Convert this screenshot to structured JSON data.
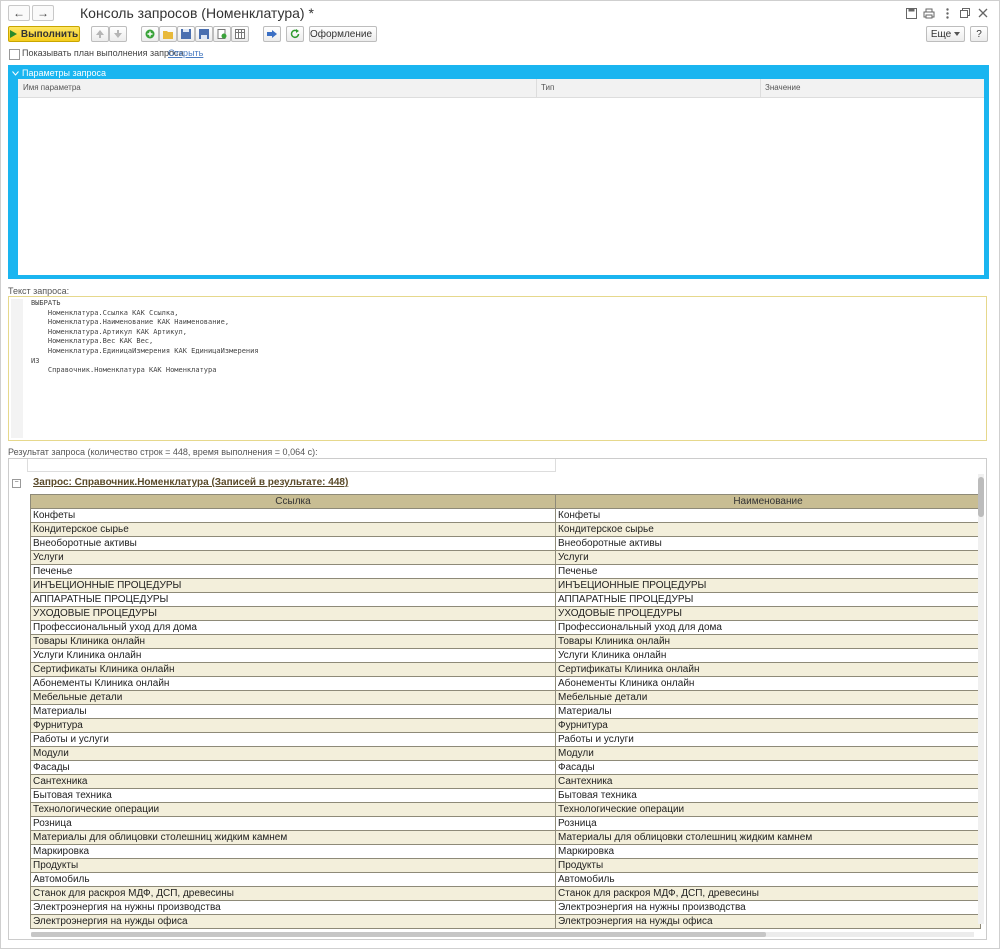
{
  "window": {
    "title": "Консоль запросов (Номенклатура) *",
    "nav_back": "←",
    "nav_forward": "→",
    "icons": [
      "save-icon",
      "print-icon",
      "menu-icon",
      "restore-icon",
      "close-icon"
    ]
  },
  "toolbar": {
    "run_label": "Выполнить",
    "design_label": "Оформление",
    "more_label": "Еще",
    "help_label": "?",
    "colors": {
      "accent": "#1ab5f0",
      "primary_button": "#f5cc1e"
    }
  },
  "options": {
    "show_plan_label": "Показывать план выполнения запроса",
    "open_link": "Открыть"
  },
  "params": {
    "header": "Параметры запроса",
    "columns": [
      "Имя параметра",
      "Тип",
      "Значение"
    ]
  },
  "query": {
    "label": "Текст запроса:",
    "text": "ВЫБРАТЬ\n    Номенклатура.Ссылка КАК Ссылка,\n    Номенклатура.Наименование КАК Наименование,\n    Номенклатура.Артикул КАК Артикул,\n    Номенклатура.Вес КАК Вес,\n    Номенклатура.ЕдиницаИзмерения КАК ЕдиницаИзмерения\nИЗ\n    Справочник.Номенклатура КАК Номенклатура"
  },
  "result": {
    "label": "Результат запроса (количество строк = 448, время выполнения = 0,064 с):",
    "title": "Запрос: Справочник.Номенклатура (Записей в результате: 448)",
    "columns": [
      "Ссылка",
      "Наименование"
    ],
    "rows": [
      [
        "Конфеты",
        "Конфеты"
      ],
      [
        "Кондитерское сырье",
        "Кондитерское сырье"
      ],
      [
        "Внеоборотные активы",
        "Внеоборотные активы"
      ],
      [
        "Услуги",
        "Услуги"
      ],
      [
        "Печенье",
        "Печенье"
      ],
      [
        "ИНЪЕЦИОННЫЕ ПРОЦЕДУРЫ",
        "ИНЪЕЦИОННЫЕ ПРОЦЕДУРЫ"
      ],
      [
        "АППАРАТНЫЕ ПРОЦЕДУРЫ",
        "АППАРАТНЫЕ ПРОЦЕДУРЫ"
      ],
      [
        "УХОДОВЫЕ ПРОЦЕДУРЫ",
        "УХОДОВЫЕ ПРОЦЕДУРЫ"
      ],
      [
        "Профессиональный уход для дома",
        "Профессиональный уход для дома"
      ],
      [
        "Товары Клиника онлайн",
        "Товары Клиника онлайн"
      ],
      [
        "Услуги Клиника онлайн",
        "Услуги Клиника онлайн"
      ],
      [
        "Сертификаты Клиника онлайн",
        "Сертификаты Клиника онлайн"
      ],
      [
        "Абонементы Клиника онлайн",
        "Абонементы Клиника онлайн"
      ],
      [
        "Мебельные детали",
        "Мебельные детали"
      ],
      [
        "Материалы",
        "Материалы"
      ],
      [
        "Фурнитура",
        "Фурнитура"
      ],
      [
        "Работы и услуги",
        "Работы и услуги"
      ],
      [
        "Модули",
        "Модули"
      ],
      [
        "Фасады",
        "Фасады"
      ],
      [
        "Сантехника",
        "Сантехника"
      ],
      [
        "Бытовая техника",
        "Бытовая техника"
      ],
      [
        "Технологические операции",
        "Технологические операции"
      ],
      [
        "Розница",
        "Розница"
      ],
      [
        "Материалы для облицовки столешниц жидким камнем",
        "Материалы для облицовки столешниц жидким камнем"
      ],
      [
        "Маркировка",
        "Маркировка"
      ],
      [
        "Продукты",
        "Продукты"
      ],
      [
        "Автомобиль",
        "Автомобиль"
      ],
      [
        "Станок для раскроя МДФ, ДСП, древесины",
        "Станок для раскроя МДФ, ДСП, древесины"
      ],
      [
        "Электроэнергия на нужны производства",
        "Электроэнергия на нужны производства"
      ],
      [
        "Электроэнергия на нужды офиса",
        "Электроэнергия на нужды офиса"
      ]
    ]
  }
}
